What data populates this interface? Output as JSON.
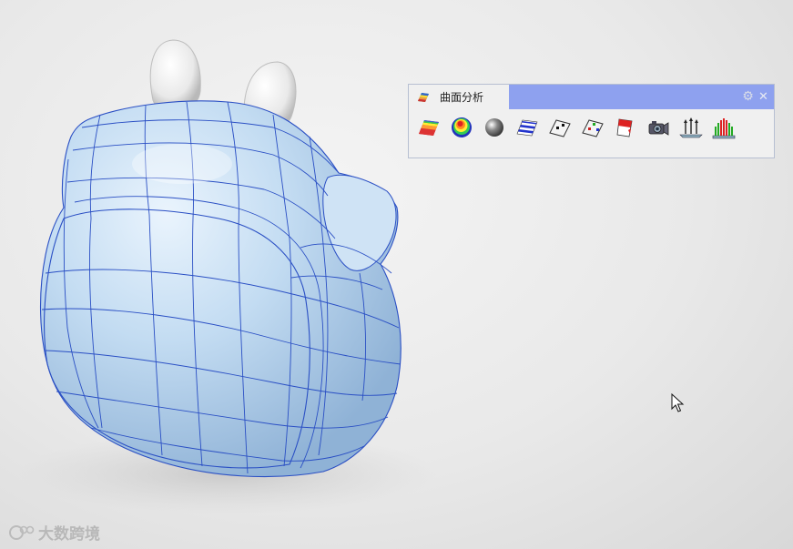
{
  "panel": {
    "tab_label": "曲面分析",
    "tab_icon": "surface-analysis-icon",
    "settings_icon": "gear-icon",
    "close_icon": "close-icon",
    "tools": [
      {
        "name": "zebra-stripes-tool",
        "icon": "zebra-analysis-icon"
      },
      {
        "name": "curvature-analysis-tool",
        "icon": "curvature-sphere-icon"
      },
      {
        "name": "environment-map-tool",
        "icon": "chrome-sphere-icon"
      },
      {
        "name": "zebra-tool",
        "icon": "zebra-stripes-icon"
      },
      {
        "name": "point-deviation-tool",
        "icon": "surface-points-icon"
      },
      {
        "name": "edge-analysis-tool",
        "icon": "edge-points-icon"
      },
      {
        "name": "draft-angle-tool",
        "icon": "draft-angle-icon"
      },
      {
        "name": "emap-camera-tool",
        "icon": "camera-icon"
      },
      {
        "name": "direction-analysis-tool",
        "icon": "normal-arrows-icon"
      },
      {
        "name": "thickness-analysis-tool",
        "icon": "histogram-icon"
      }
    ],
    "colors": {
      "tabbar": "#8ea1ef",
      "panel_bg": "#f0f0f0"
    }
  },
  "model": {
    "icon": "3d-model-surface",
    "color": "#b9d5ef",
    "isocurve_color": "#2a4fc4"
  },
  "watermark": {
    "text": "大数跨境"
  }
}
